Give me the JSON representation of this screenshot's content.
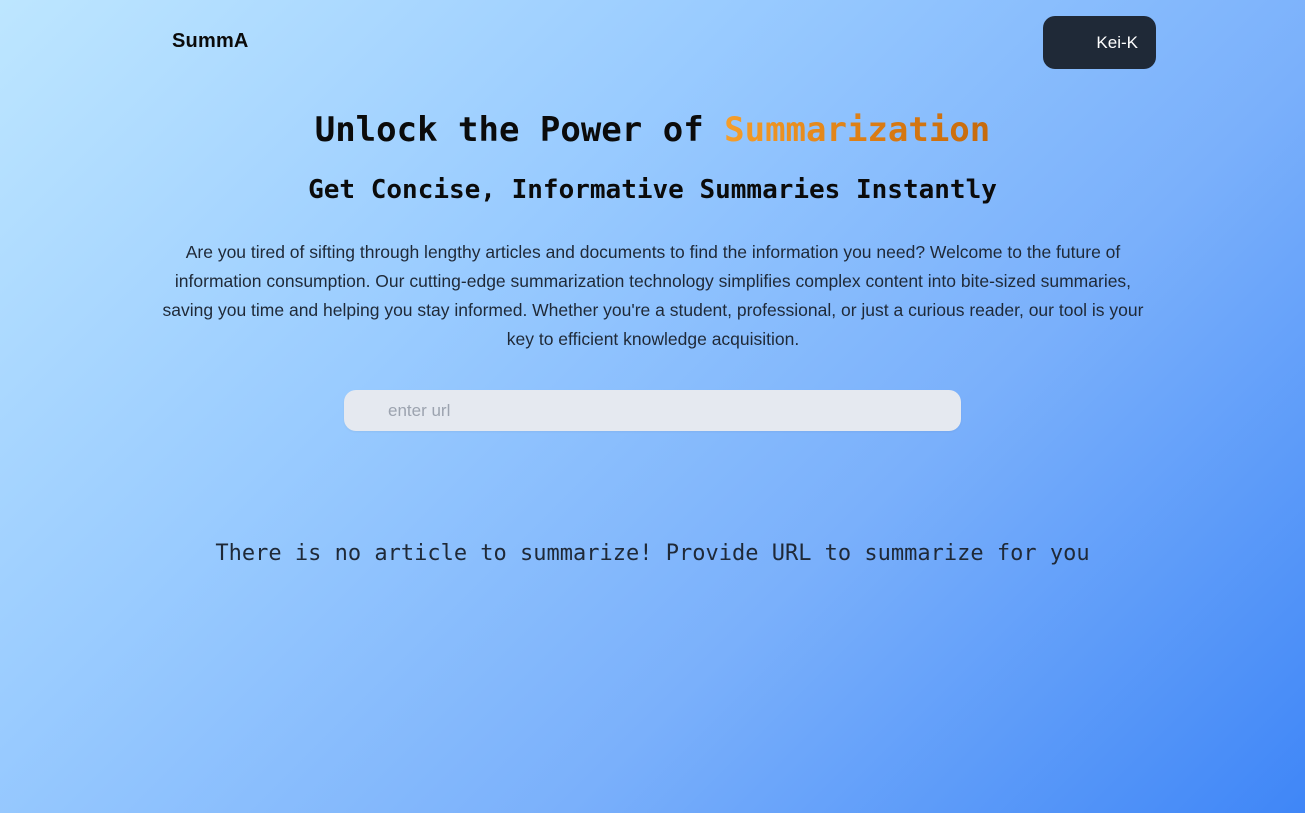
{
  "header": {
    "logo": "SummA",
    "user_button": "Kei-K"
  },
  "hero": {
    "title_prefix": "Unlock the Power of ",
    "title_accent": "Summarization",
    "subtitle": "Get Concise, Informative Summaries Instantly",
    "description": "Are you tired of sifting through lengthy articles and documents to find the information you need? Welcome to the future of information consumption. Our cutting-edge summarization technology simplifies complex content into bite-sized summaries, saving you time and helping you stay informed. Whether you're a student, professional, or just a curious reader, our tool is your key to efficient knowledge acquisition."
  },
  "search": {
    "placeholder": "enter url",
    "value": ""
  },
  "result": {
    "empty_message": "There is no article to summarize! Provide URL to summarize for you"
  },
  "colors": {
    "accent_start": "#f59e2b",
    "accent_end": "#c56a0d",
    "button_bg": "#1f2937",
    "input_bg": "#e5e9f0"
  }
}
